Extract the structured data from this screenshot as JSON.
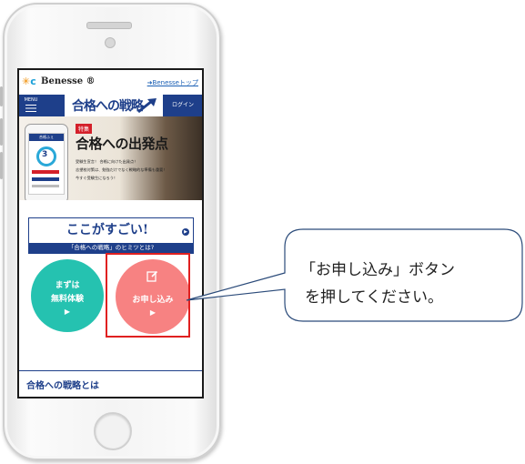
{
  "site": {
    "brand": "Benesse ®",
    "top_link": "➜Benesseトップ",
    "menu_label": "MENU",
    "brand_title": "合格への戦略",
    "login_label": "ログイン"
  },
  "hero": {
    "badge": "特集",
    "title": "合格への出発点",
    "lines": [
      "受験生宣言！ 合格に向けた出発点！",
      "志望校対策は、勉強だけでなく戦略的な準備も重要！",
      "今すぐ受験生になろう！"
    ],
    "phone_header": "合格ふぇ",
    "phone_number": "3"
  },
  "banner": {
    "main": "ここがすごい!",
    "sub": "「合格への戦略」のヒミツとは?",
    "arrow": "▶"
  },
  "buttons": {
    "trial_line1": "まずは",
    "trial_line2": "無料体験",
    "trial_play": "▶",
    "apply_label": "お申し込み",
    "apply_play": "▶"
  },
  "section": {
    "about": "合格への戦略とは"
  },
  "callout": {
    "line1": "「お申し込み」ボタン",
    "line2": "を押してください。"
  },
  "colors": {
    "navy": "#1e3f8a",
    "teal": "#25c2b0",
    "coral": "#f78282",
    "highlight": "#e02020"
  }
}
